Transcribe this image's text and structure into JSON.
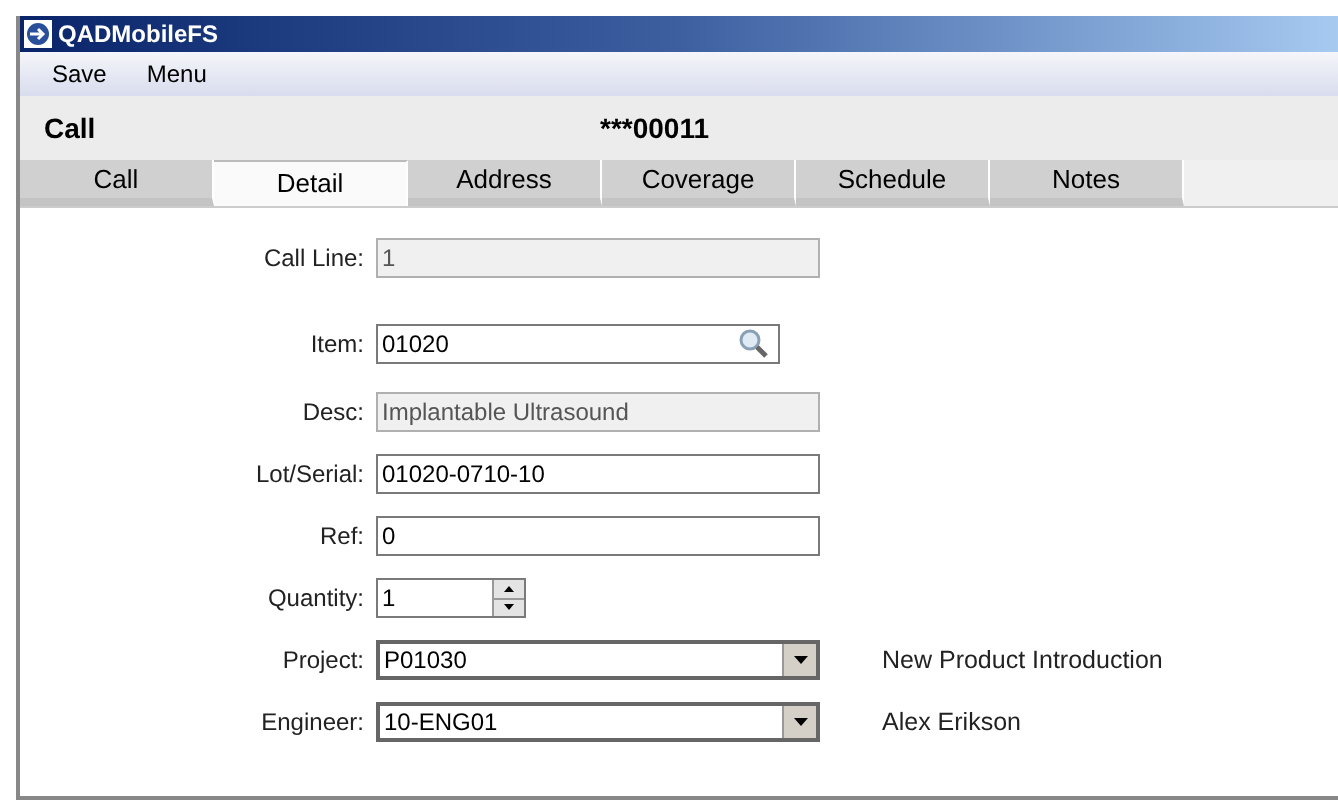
{
  "window": {
    "title": "QADMobileFS"
  },
  "menu": [
    "Save",
    "Menu"
  ],
  "header": {
    "title": "Call",
    "record": "***00011"
  },
  "tabs": [
    {
      "label": "Call",
      "selected": false
    },
    {
      "label": "Detail",
      "selected": true
    },
    {
      "label": "Address",
      "selected": false
    },
    {
      "label": "Coverage",
      "selected": false
    },
    {
      "label": "Schedule",
      "selected": false
    },
    {
      "label": "Notes",
      "selected": false
    }
  ],
  "fields": [
    {
      "label": "Call Line:",
      "value": "1",
      "kind": "readonly"
    },
    {
      "label": "Item:",
      "value": "01020",
      "kind": "lookup"
    },
    {
      "label": "Desc:",
      "value": "Implantable Ultrasound",
      "kind": "readonly"
    },
    {
      "label": "Lot/Serial:",
      "value": "01020-0710-10",
      "kind": "text"
    },
    {
      "label": "Ref:",
      "value": "0",
      "kind": "text"
    },
    {
      "label": "Quantity:",
      "value": "1",
      "kind": "spinner"
    },
    {
      "label": "Project:",
      "value": "P01030",
      "kind": "dropdown",
      "note": "New Product Introduction"
    },
    {
      "label": "Engineer:",
      "value": "10-ENG01",
      "kind": "dropdown",
      "note": "Alex Erikson"
    }
  ]
}
